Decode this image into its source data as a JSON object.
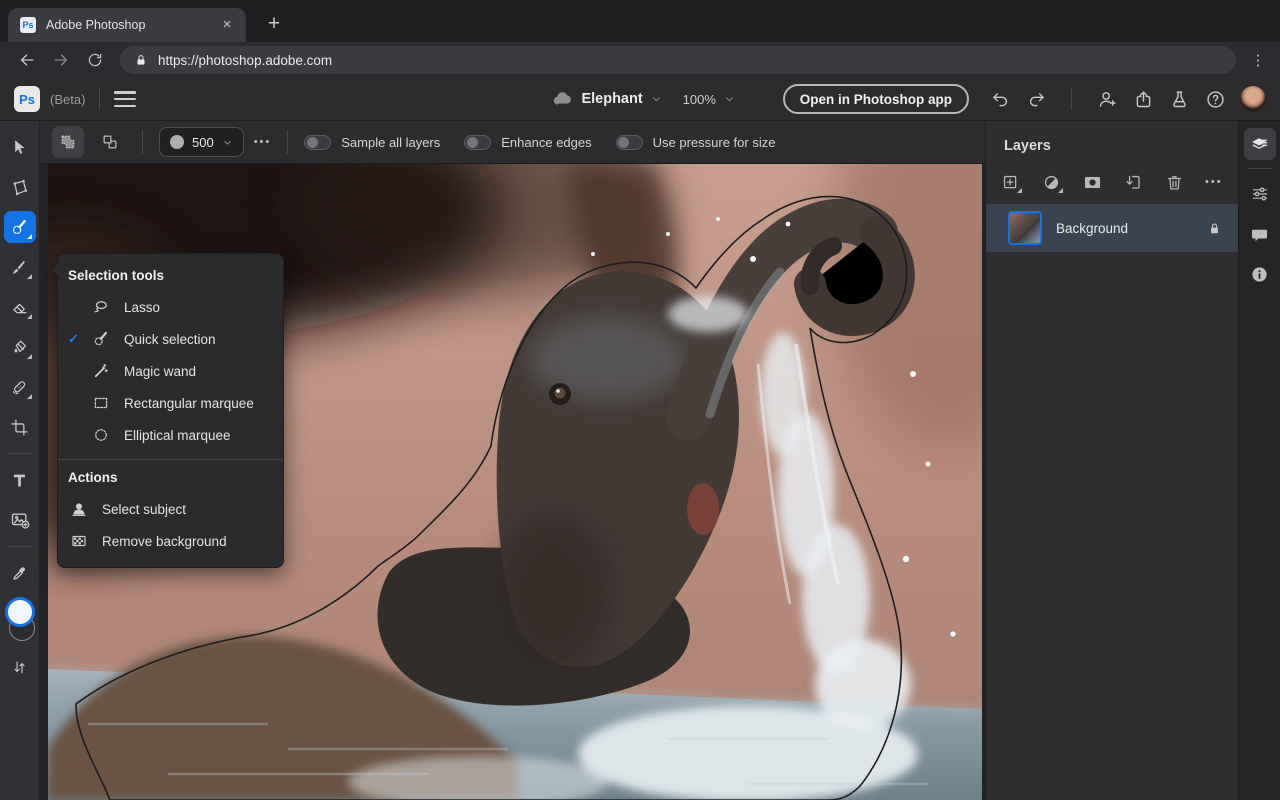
{
  "browser": {
    "tab_title": "Adobe Photoshop",
    "favicon_text": "Ps",
    "url": "https://photoshop.adobe.com",
    "glyphs": {
      "close": "×",
      "new_tab": "+",
      "menu": "⋮"
    }
  },
  "header": {
    "logo_text": "Ps",
    "beta_label": "(Beta)",
    "document_name": "Elephant",
    "zoom_level": "100%",
    "open_app_button": "Open in Photoshop app"
  },
  "options_bar": {
    "brush_size": "500",
    "more_glyph": "•••",
    "toggles": [
      {
        "label": "Sample all layers",
        "on": false
      },
      {
        "label": "Enhance edges",
        "on": false
      },
      {
        "label": "Use pressure for size",
        "on": false
      }
    ]
  },
  "selection_menu": {
    "title": "Selection tools",
    "check_glyph": "✓",
    "items": [
      {
        "label": "Lasso",
        "checked": false
      },
      {
        "label": "Quick selection",
        "checked": true
      },
      {
        "label": "Magic wand",
        "checked": false
      },
      {
        "label": "Rectangular marquee",
        "checked": false
      },
      {
        "label": "Elliptical marquee",
        "checked": false
      }
    ],
    "actions_title": "Actions",
    "actions": [
      {
        "label": "Select subject"
      },
      {
        "label": "Remove background"
      }
    ]
  },
  "layers_panel": {
    "title": "Layers",
    "more_glyph": "•••",
    "layers": [
      {
        "name": "Background",
        "locked": true,
        "selected": true
      }
    ]
  },
  "colors": {
    "accent": "#1473e6",
    "selected_layer_row": "#3a4450"
  }
}
